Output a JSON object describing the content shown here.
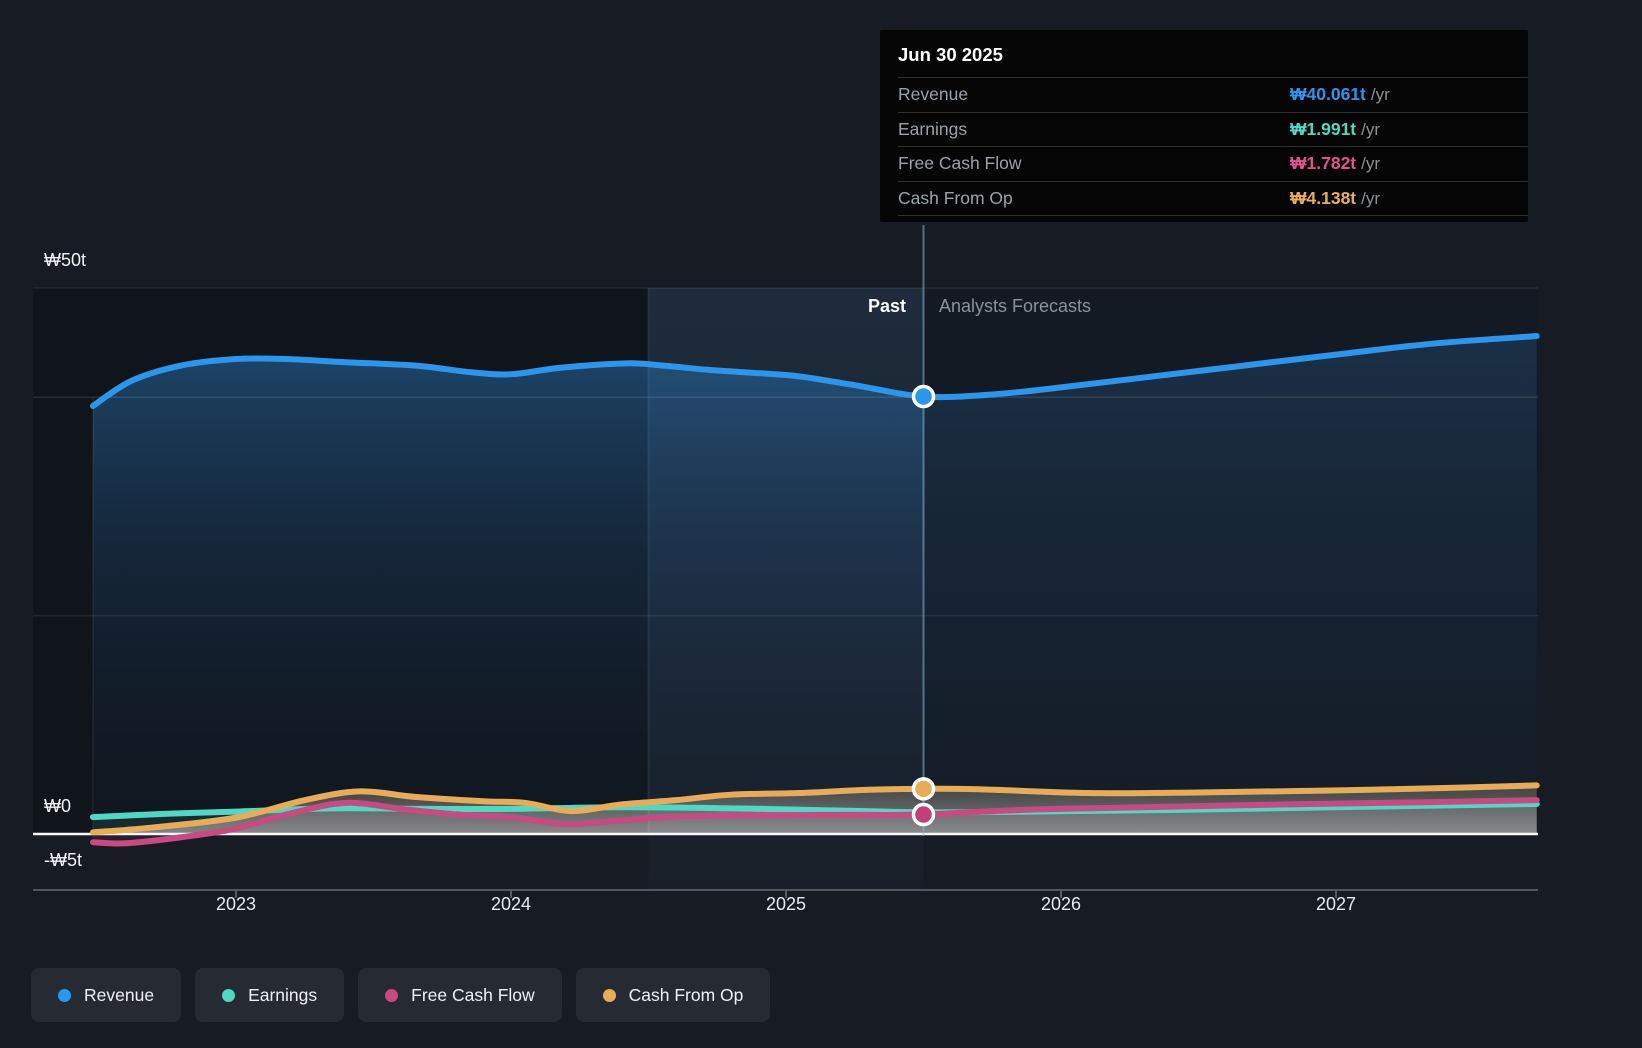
{
  "page": {
    "background": "#171B23"
  },
  "labels": {
    "past": "Past",
    "forecast": "Analysts Forecasts"
  },
  "y_axis": [
    "₩50t",
    "₩0",
    "-₩5t"
  ],
  "x_axis": [
    "2023",
    "2024",
    "2025",
    "2026",
    "2027"
  ],
  "tooltip": {
    "date": "Jun 30 2025",
    "rows": [
      {
        "label": "Revenue",
        "value": "₩40.061t",
        "unit": "/yr",
        "color": "#2B96EC"
      },
      {
        "label": "Earnings",
        "value": "₩1.991t",
        "unit": "/yr",
        "color": "#4FD8C4"
      },
      {
        "label": "Free Cash Flow",
        "value": "₩1.782t",
        "unit": "/yr",
        "color": "#E0538F"
      },
      {
        "label": "Cash From Op",
        "value": "₩4.138t",
        "unit": "/yr",
        "color": "#E9AE57"
      }
    ]
  },
  "legend": [
    {
      "label": "Revenue",
      "color": "#2B96EC"
    },
    {
      "label": "Earnings",
      "color": "#4FD8C4"
    },
    {
      "label": "Free Cash Flow",
      "color": "#C94A82"
    },
    {
      "label": "Cash From Op",
      "color": "#E8AC58"
    }
  ],
  "chart_data": {
    "type": "line",
    "unit": "trillion KRW (t)",
    "x_range": [
      2022.48,
      2027.73
    ],
    "divider_x": 2025.5,
    "divider_date": "Jun 30 2025",
    "x_ticks": [
      2023,
      2024,
      2025,
      2026,
      2027
    ],
    "y_gridlines": [
      50,
      40,
      20,
      0,
      -5
    ],
    "y_labeled": [
      50,
      0,
      -5
    ],
    "series": [
      {
        "name": "Revenue",
        "color": "#2B96EC",
        "points": [
          [
            2022.48,
            39.2
          ],
          [
            2022.62,
            41.5
          ],
          [
            2022.8,
            42.9
          ],
          [
            2023.0,
            43.5
          ],
          [
            2023.18,
            43.5
          ],
          [
            2023.4,
            43.2
          ],
          [
            2023.65,
            42.9
          ],
          [
            2023.85,
            42.3
          ],
          [
            2024.0,
            42.1
          ],
          [
            2024.18,
            42.7
          ],
          [
            2024.42,
            43.1
          ],
          [
            2024.55,
            42.9
          ],
          [
            2024.72,
            42.5
          ],
          [
            2024.9,
            42.2
          ],
          [
            2025.05,
            41.9
          ],
          [
            2025.25,
            41.1
          ],
          [
            2025.5,
            40.061
          ],
          [
            2025.75,
            40.25
          ],
          [
            2026.0,
            40.9
          ],
          [
            2026.3,
            41.8
          ],
          [
            2026.6,
            42.7
          ],
          [
            2027.0,
            43.9
          ],
          [
            2027.35,
            44.9
          ],
          [
            2027.73,
            45.6
          ]
        ]
      },
      {
        "name": "Earnings",
        "color": "#4FD8C4",
        "points": [
          [
            2022.48,
            1.55
          ],
          [
            2022.75,
            1.85
          ],
          [
            2023.0,
            2.05
          ],
          [
            2023.35,
            2.35
          ],
          [
            2023.7,
            2.3
          ],
          [
            2024.0,
            2.3
          ],
          [
            2024.4,
            2.45
          ],
          [
            2024.8,
            2.35
          ],
          [
            2025.1,
            2.2
          ],
          [
            2025.5,
            1.991
          ],
          [
            2025.9,
            2.05
          ],
          [
            2026.4,
            2.2
          ],
          [
            2027.0,
            2.45
          ],
          [
            2027.73,
            2.75
          ]
        ]
      },
      {
        "name": "Free Cash Flow",
        "color": "#C94A82",
        "points": [
          [
            2022.48,
            -0.75
          ],
          [
            2022.6,
            -0.85
          ],
          [
            2022.8,
            -0.3
          ],
          [
            2023.0,
            0.5
          ],
          [
            2023.2,
            1.9
          ],
          [
            2023.4,
            2.85
          ],
          [
            2023.6,
            2.3
          ],
          [
            2023.8,
            1.8
          ],
          [
            2024.0,
            1.55
          ],
          [
            2024.2,
            0.9
          ],
          [
            2024.4,
            1.25
          ],
          [
            2024.6,
            1.6
          ],
          [
            2024.85,
            1.72
          ],
          [
            2025.2,
            1.75
          ],
          [
            2025.5,
            1.782
          ],
          [
            2025.85,
            2.2
          ],
          [
            2026.3,
            2.45
          ],
          [
            2026.8,
            2.7
          ],
          [
            2027.3,
            2.9
          ],
          [
            2027.73,
            3.1
          ]
        ]
      },
      {
        "name": "Cash From Op",
        "color": "#E8AC58",
        "points": [
          [
            2022.48,
            0.15
          ],
          [
            2022.7,
            0.6
          ],
          [
            2023.0,
            1.5
          ],
          [
            2023.25,
            3.1
          ],
          [
            2023.45,
            3.9
          ],
          [
            2023.65,
            3.4
          ],
          [
            2023.9,
            3.0
          ],
          [
            2024.05,
            2.85
          ],
          [
            2024.22,
            2.1
          ],
          [
            2024.4,
            2.7
          ],
          [
            2024.6,
            3.1
          ],
          [
            2024.8,
            3.6
          ],
          [
            2025.05,
            3.75
          ],
          [
            2025.3,
            4.05
          ],
          [
            2025.5,
            4.138
          ],
          [
            2025.7,
            4.1
          ],
          [
            2026.1,
            3.75
          ],
          [
            2026.5,
            3.8
          ],
          [
            2026.9,
            3.95
          ],
          [
            2027.3,
            4.15
          ],
          [
            2027.73,
            4.45
          ]
        ]
      }
    ],
    "markers": [
      {
        "series": "Revenue",
        "x": 2025.5,
        "value": 40.061,
        "color": "#2B96EC"
      },
      {
        "series": "Cash From Op",
        "x": 2025.5,
        "value": 4.138,
        "color": "#E8AC58"
      },
      {
        "series": "Free Cash Flow",
        "x": 2025.5,
        "value": 1.782,
        "color": "#C0407A"
      }
    ]
  }
}
